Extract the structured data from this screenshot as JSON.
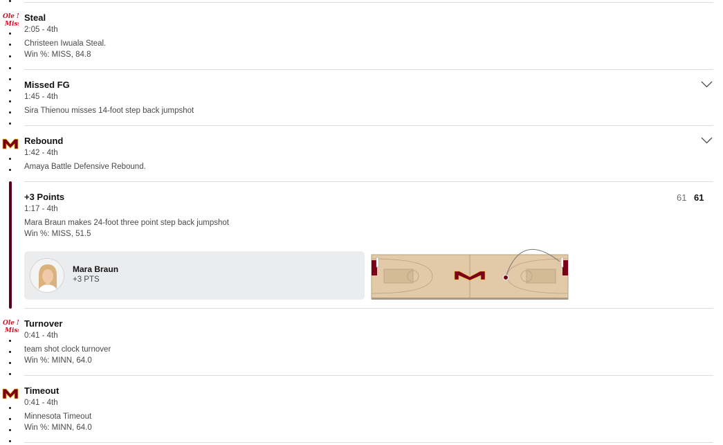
{
  "colors": {
    "minnesota_maroon": "#7a0019",
    "ole_miss_red": "#ce1126",
    "text_primary": "#121213",
    "text_secondary": "#48494a",
    "card_bg": "#ebecee",
    "court_wood": "#e2c9a8"
  },
  "plays": [
    {
      "team_logo": "ole-miss-logo",
      "logo_text": "Ole Miss",
      "title": "Steal",
      "time": "2:05 - 4th",
      "description": "Christeen Iwuala Steal.",
      "win_pct": "Win %: MISS, 84.8",
      "expandable": false
    },
    {
      "team_logo": "",
      "title": "Missed FG",
      "time": "1:45 - 4th",
      "description": "Sira Thienou misses 14-foot step back jumpshot",
      "expandable": true,
      "expand_icon": "chevron-down-icon"
    },
    {
      "team_logo": "minnesota-logo",
      "title": "Rebound",
      "time": "1:42 - 4th",
      "description": "Amaya Battle Defensive Rebound.",
      "expandable": true,
      "expand_icon": "chevron-down-icon"
    },
    {
      "team_logo": "",
      "title": "+3 Points",
      "time": "1:17 - 4th",
      "description": "Mara Braun makes 24-foot three point step back jumpshot",
      "win_pct": "Win %: MISS, 51.5",
      "scoring_play": true,
      "score_away": "61",
      "score_home": "61",
      "player": {
        "name": "Mara Braun",
        "stat": "+3 PTS",
        "headshot_icon": "player-headshot"
      }
    },
    {
      "team_logo": "ole-miss-logo",
      "logo_text": "Ole Miss",
      "title": "Turnover",
      "time": "0:41 - 4th",
      "description": "team shot clock turnover",
      "win_pct": "Win %: MINN, 64.0"
    },
    {
      "team_logo": "minnesota-logo",
      "title": "Timeout",
      "time": "0:41 - 4th",
      "description": "Minnesota Timeout",
      "win_pct": "Win %: MINN, 64.0"
    }
  ]
}
